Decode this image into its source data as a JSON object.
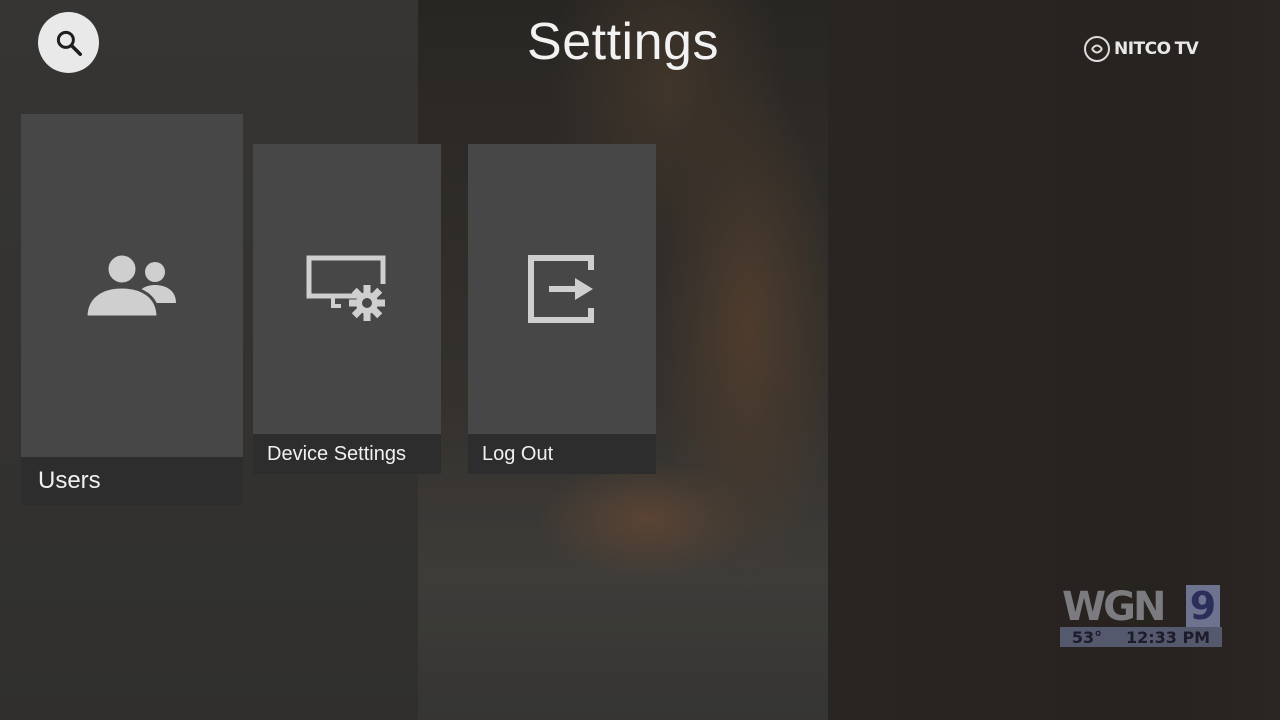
{
  "header": {
    "title": "Settings",
    "search_icon": "search-icon",
    "brand": {
      "name": "NITCO TV",
      "logo_text": "NITCO",
      "logo_suffix": "TV"
    }
  },
  "tiles": [
    {
      "id": "users",
      "label": "Users",
      "icon": "users-icon"
    },
    {
      "id": "device-settings",
      "label": "Device Settings",
      "icon": "device-settings-icon"
    },
    {
      "id": "log-out",
      "label": "Log Out",
      "icon": "log-out-icon"
    }
  ],
  "channel_bug": {
    "call_letters": "WGN",
    "channel_number": "9",
    "temperature": "53°",
    "time": "12:33 PM"
  },
  "colors": {
    "tile_bg": "#474747",
    "tile_label_bg": "#2d2d2d",
    "icon": "#cfcfcf",
    "title_text": "#f2f2f2",
    "search_button_bg": "#e9e9e9"
  }
}
